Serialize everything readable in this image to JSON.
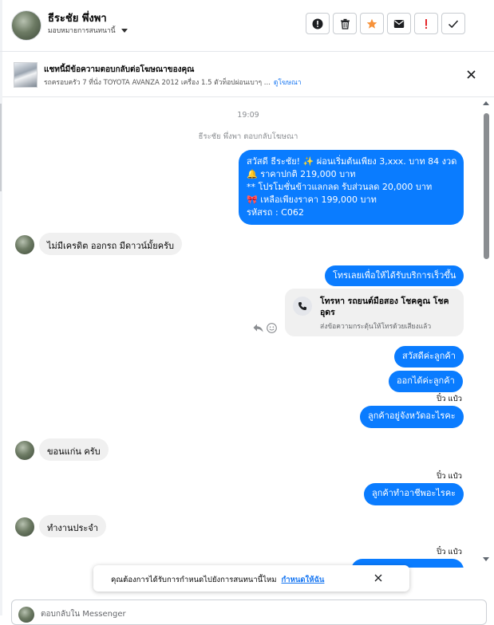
{
  "header": {
    "name": "ธีระชัย พึ่งพา",
    "subtitle": "มอบหมายการสนทนานี้",
    "toolbar": [
      {
        "icon": "alert-circle-icon",
        "color": "#1c1e21"
      },
      {
        "icon": "trash-icon",
        "color": "#1c1e21"
      },
      {
        "icon": "star-icon",
        "color": "#f7923a"
      },
      {
        "icon": "envelope-icon",
        "color": "#1c1e21"
      },
      {
        "icon": "exclamation-icon",
        "color": "#e4262a"
      },
      {
        "icon": "check-icon",
        "color": "#1c1e21"
      }
    ]
  },
  "ad_banner": {
    "title": "แชทนี้มีข้อความตอบกลับต่อโฆษณาของคุณ",
    "description": "รถครอบครัว 7 ที่นั่ง TOYOTA AVANZA 2012 เครื่อง 1.5 ตัวท็อปผ่อนเบาๆ ...",
    "link": "ดูโฆษณา"
  },
  "chat": {
    "timestamp": "19:09",
    "system_line": "ธีระชัย พึ่งพา ตอบกลับโฆษณา",
    "ad_reply_lines": [
      "สวัสดี ธีระชัย! ✨  ผ่อนเริ่มต้นเพียง 3,xxx. บาท 84 งวด",
      "🔔 ราคาปกติ 219,000 บาท",
      "** โปรโมชั่นข้าวแลกลด รับส่วนลด 20,000 บาท",
      "🎀  เหลือเพียงราคา 199,000 บาท",
      " รหัสรถ : C062"
    ],
    "msg_in_1": "ไม่มีเครดิต ออกรถ มีดาวน์มั้ยครับ",
    "msg_out_call_prompt": "โทรเลยเพื่อให้ได้รับบริการเร็วขึ้น",
    "call_card": {
      "title": "โทรหา รถยนต์มือสอง โชคคูณ โชค อุดร",
      "subtitle": "ส่งข้อความกระตุ้นให้โทรด้วยเสียงแล้ว"
    },
    "msg_out_2": "สวัสดีค่ะลูกค้า",
    "msg_out_3": "ออกได้ค่ะลูกค้า",
    "sender_1": "ปิ๋ว แป๋ว",
    "msg_out_4": "ลูกค้าอยู่จังหวัดอะไรคะ",
    "msg_in_2": "ขอนแก่น ครับ",
    "sender_2": "ปิ๋ว แป๋ว",
    "msg_out_5": "ลูกค้าทำอาชีพอะไรคะ",
    "msg_in_3": "ทำงานประจำ",
    "sender_3": "ปิ๋ว แป๋ว"
  },
  "toast": {
    "text": "คุณต้องการได้รับการกำหนดไปยังการสนทนานี้ไหม",
    "link": "กำหนดให้ฉัน"
  },
  "composer": {
    "placeholder": "ตอบกลับใน Messenger"
  }
}
